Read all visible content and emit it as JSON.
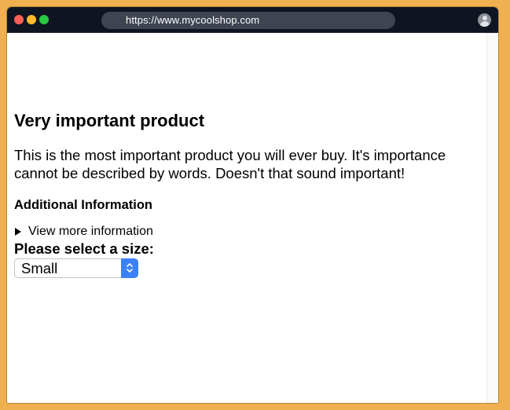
{
  "browser": {
    "url": "https://www.mycoolshop.com"
  },
  "product": {
    "title": "Very important product",
    "description": "This is the most important product you will ever buy. It's importance cannot be described by words. Doesn't that sound important!"
  },
  "additional_info": {
    "heading": "Additional Information",
    "summary_label": "View more information"
  },
  "size_selector": {
    "label": "Please select a size:",
    "selected_value": "Small"
  },
  "colors": {
    "page_background": "#f0b04f",
    "titlebar": "#0f1520",
    "select_accent": "#3b82f6"
  }
}
